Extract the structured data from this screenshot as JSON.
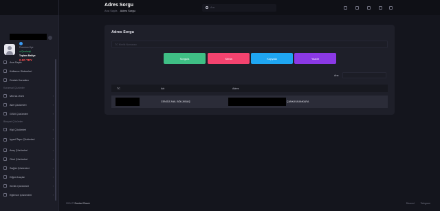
{
  "header": {
    "title": "Adres Sorgu",
    "breadcrumb": [
      "Ana Sayfa",
      "Adres Sorgu"
    ],
    "search_placeholder": "Ara"
  },
  "profile": {
    "line1": "Premium Üye",
    "line2": "● Çevrimiçi",
    "line3": "Toplam Bakiye",
    "balance": "0.00 TRY"
  },
  "sidebar": {
    "top_items": [
      {
        "label": "Ana Sayfa"
      },
      {
        "label": "Kullanıcı Sistemleri"
      },
      {
        "label": "Destek Kanalları"
      }
    ],
    "section1": "Kurumsal Çözümler",
    "group1": [
      {
        "label": "Mernis 2024"
      },
      {
        "label": "Aile Çözümleri"
      },
      {
        "label": "GSM Çözümleri"
      }
    ],
    "section2": "Bireysel Çözümler",
    "group2": [
      {
        "label": "Kişi Çözümleri"
      },
      {
        "label": "İşyeri/Tapu Çözümleri"
      },
      {
        "label": "Araç Çözümleri"
      },
      {
        "label": "Okul Çözümleri"
      },
      {
        "label": "Sağlık Çözümleri"
      },
      {
        "label": "Diğer Araçlar"
      },
      {
        "label": "Kimlik Çözümleri"
      },
      {
        "label": "Eğlence Çözümleri"
      }
    ]
  },
  "card": {
    "title": "Adres Sorgu",
    "input_placeholder": "TC Kimlik Numarası",
    "buttons": [
      "Sorgula",
      "Sıfırla",
      "Kopyala",
      "Yazdır"
    ],
    "filter_label": "Ara:"
  },
  "table": {
    "columns": [
      "TC",
      "Adı",
      "Adres"
    ],
    "rows": [
      {
        "tc": "",
        "ad": "CENGİZ ANIL BÖLÜKBAŞ",
        "adres": "ÇANKAYA/ANKARA"
      }
    ]
  },
  "footer": {
    "year": "2024 ©",
    "brand": "Sorried Check",
    "links": [
      "Discord",
      "Telegram"
    ]
  },
  "colors": {
    "sorgula": "#3fbf85",
    "sifirla": "#f4436f",
    "kopyala": "#1fa6f2",
    "yazdir": "#8b39e5",
    "balance": "#ff4f4f",
    "online": "#2ecc71"
  }
}
